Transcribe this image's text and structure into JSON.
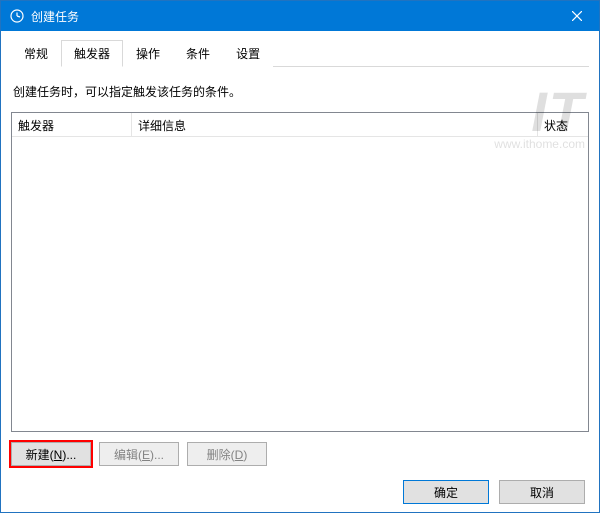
{
  "window": {
    "title": "创建任务"
  },
  "tabs": {
    "general": "常规",
    "triggers": "触发器",
    "actions": "操作",
    "conditions": "条件",
    "settings": "设置"
  },
  "description": "创建任务时，可以指定触发该任务的条件。",
  "table": {
    "columns": {
      "trigger": "触发器",
      "details": "详细信息",
      "status": "状态"
    }
  },
  "buttons": {
    "new": "新建(N)...",
    "edit": "编辑(E)...",
    "delete": "删除(D)",
    "ok": "确定",
    "cancel": "取消"
  },
  "watermark": {
    "logo": "IT",
    "url": "www.ithome.com"
  }
}
